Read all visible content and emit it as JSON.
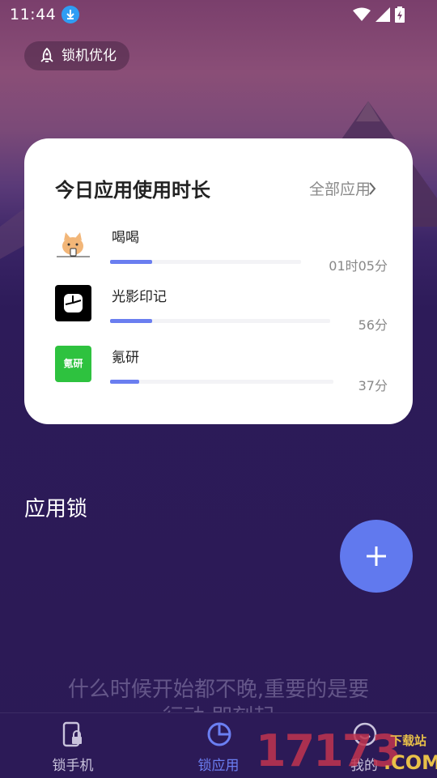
{
  "status_bar": {
    "time": "11:44"
  },
  "pill": {
    "label": "锁机优化"
  },
  "card": {
    "title": "今日应用使用时长",
    "all_apps": "全部应用",
    "apps": [
      {
        "name": "喝喝",
        "duration": "01时05分",
        "progress": 0.22
      },
      {
        "name": "光影印记",
        "duration": "56分",
        "progress": 0.19
      },
      {
        "name": "氪研",
        "duration": "37分",
        "progress": 0.13
      }
    ],
    "app3_icon_text": "氪研"
  },
  "section": {
    "title": "应用锁"
  },
  "quote": {
    "text": "什么时候开始都不晚,重要的是要行动,即刻起"
  },
  "nav": {
    "items": [
      {
        "label": "锁手机",
        "active": false
      },
      {
        "label": "锁应用",
        "active": true
      },
      {
        "label": "我的",
        "active": false
      }
    ]
  },
  "watermark": {
    "number": "17173",
    "site": "下载站",
    "dotcom": ".COM"
  },
  "colors": {
    "accent": "#6179ee",
    "progress": "#6a7ef0",
    "nav_active": "#6b7ff2",
    "nav_inactive": "#c9c3dc"
  }
}
